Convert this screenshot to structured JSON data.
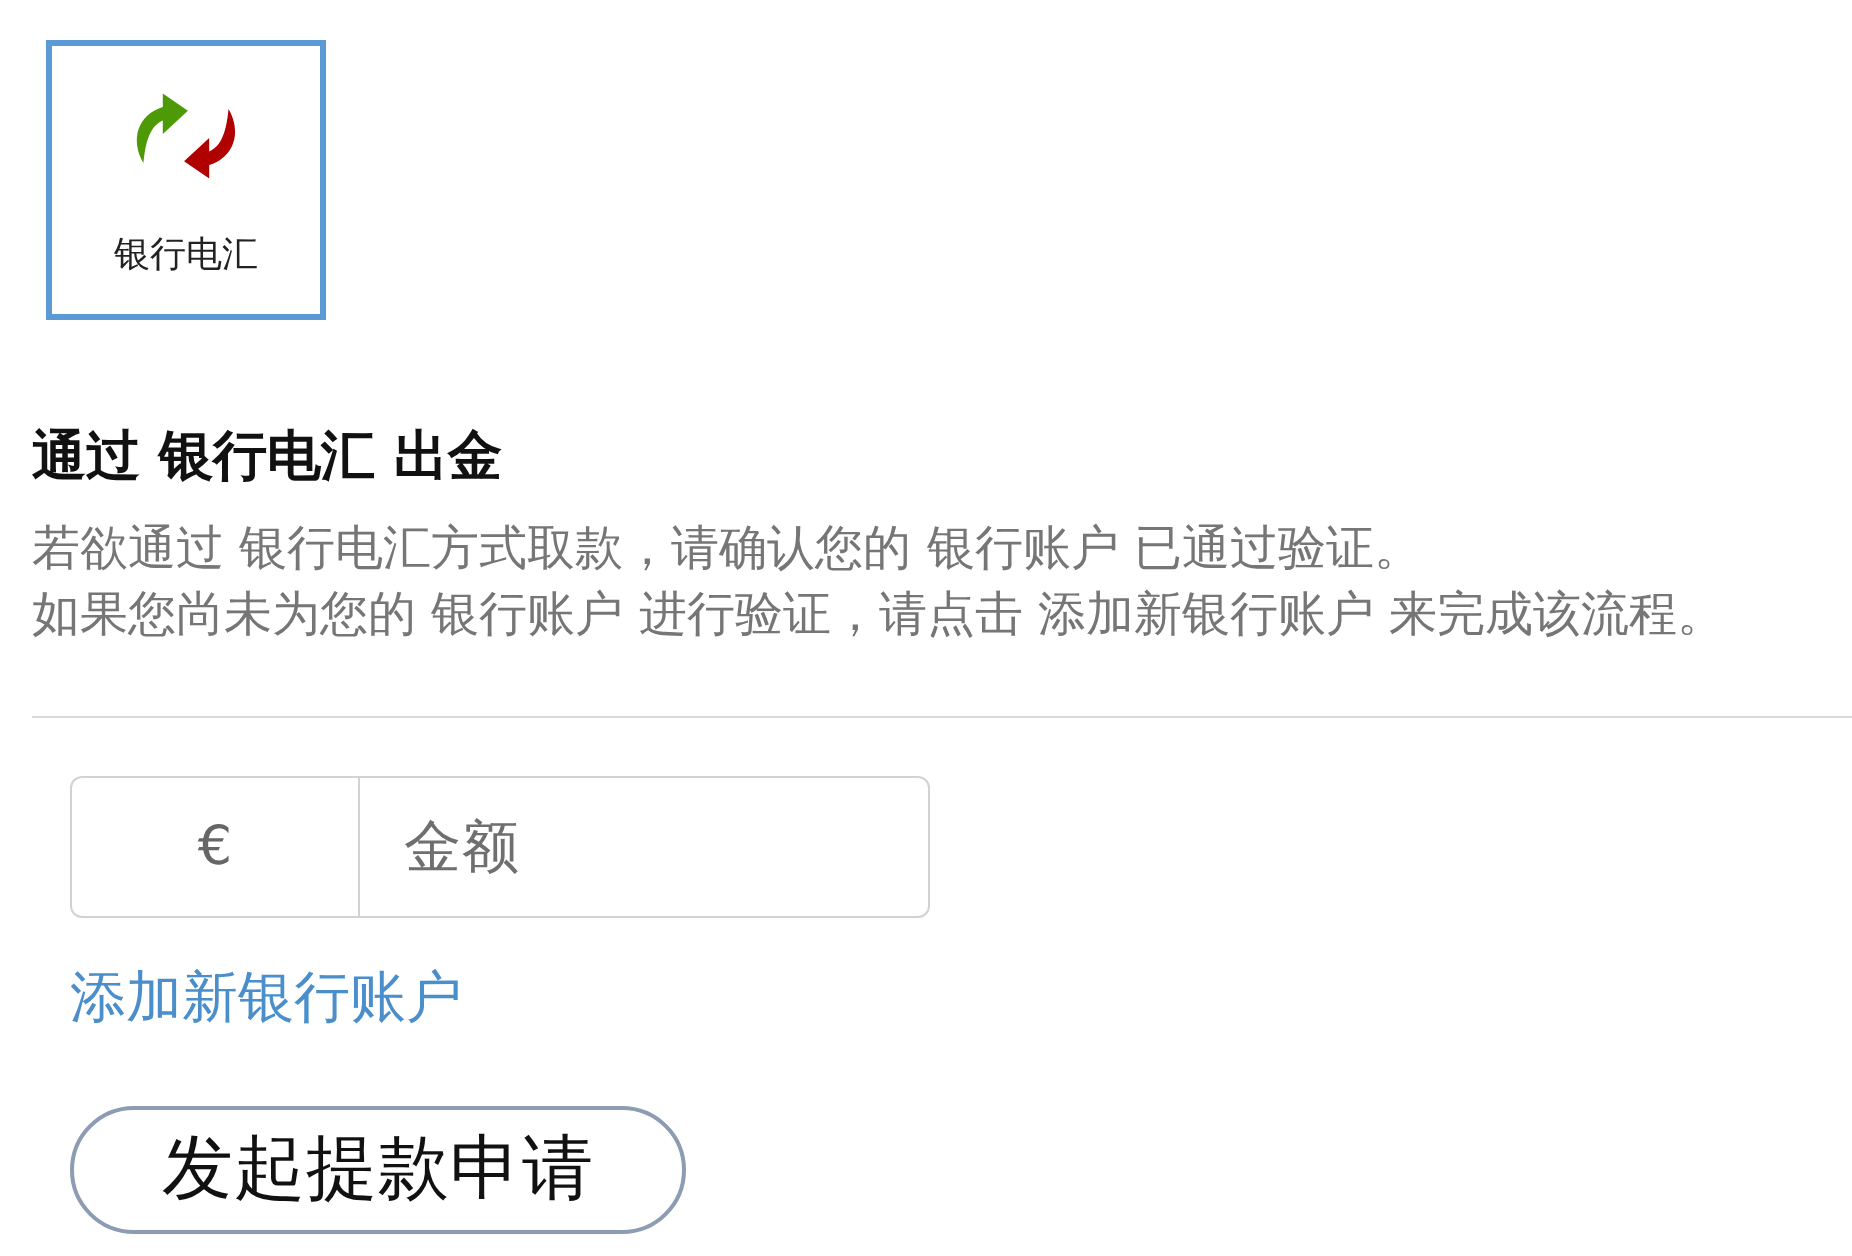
{
  "payment_methods": [
    {
      "label": "银行电汇",
      "selected": true
    }
  ],
  "heading": "通过 银行电汇 出金",
  "description": [
    "若欲通过 银行电汇方式取款，请确认您的 银行账户 已通过验证。",
    "如果您尚未为您的 银行账户 进行验证，请点击 添加新银行账户 来完成该流程。"
  ],
  "amount": {
    "currency": "€",
    "placeholder": "金额"
  },
  "add_account_link": "添加新银行账户",
  "submit_button": "发起提款申请"
}
